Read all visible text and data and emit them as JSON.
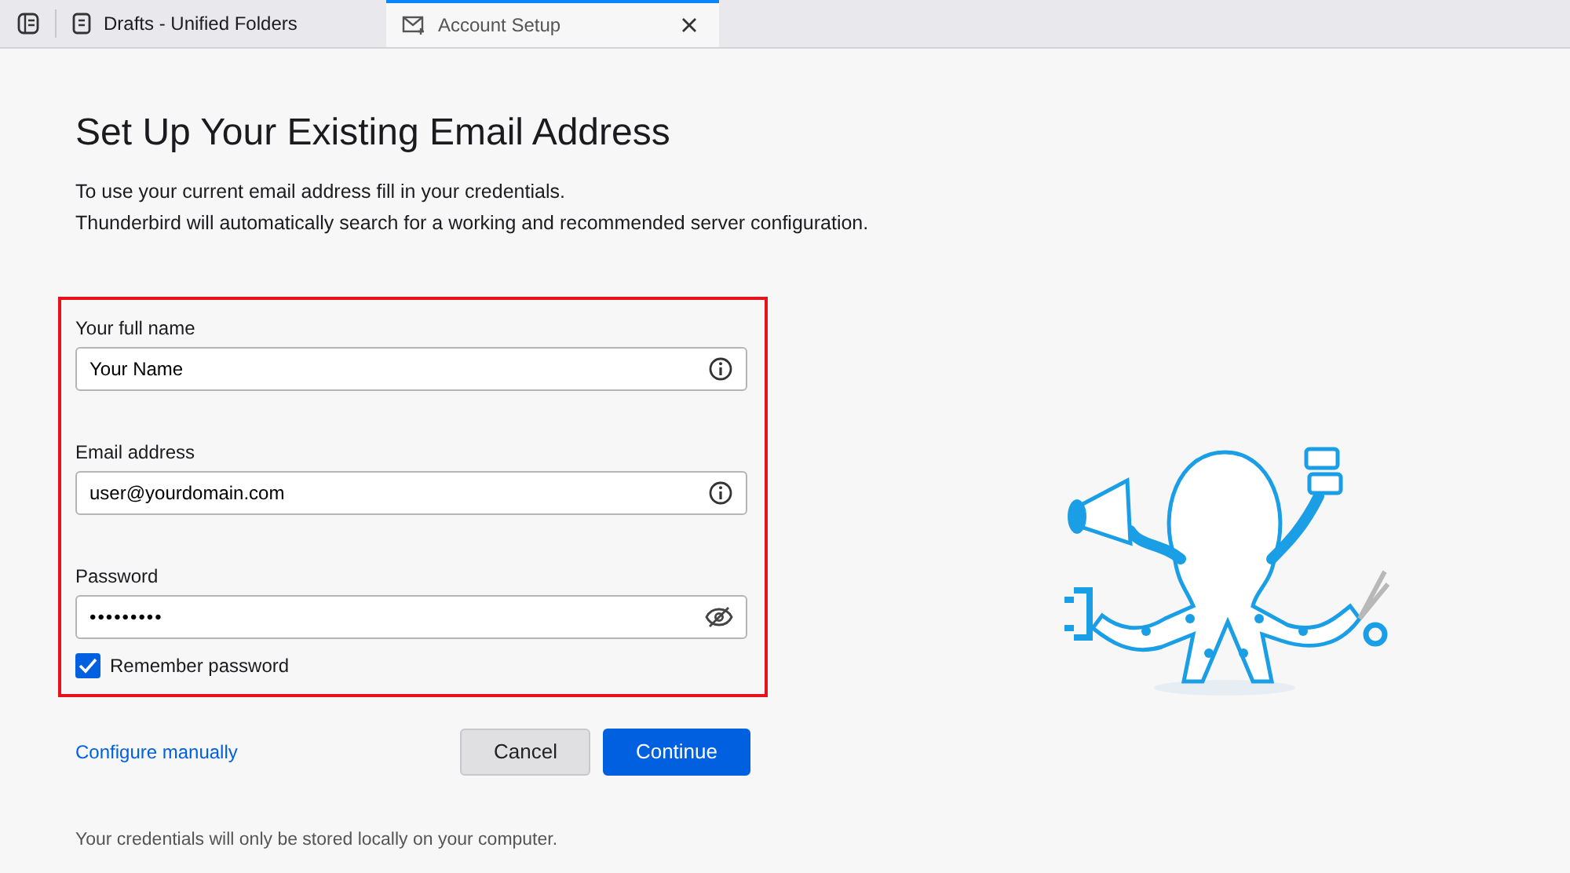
{
  "tabs": [
    {
      "label": "Drafts - Unified Folders",
      "kind": "folder",
      "selected": false,
      "closable": false
    },
    {
      "label": "Account Setup",
      "kind": "mail",
      "selected": true,
      "closable": true
    }
  ],
  "heading": "Set Up Your Existing Email Address",
  "intro": [
    "To use your current email address fill in your credentials.",
    "Thunderbird will automatically search for a working and recommended server configuration."
  ],
  "fields": [
    {
      "label": "Your full name",
      "value": "Your Name",
      "kind": "info"
    },
    {
      "label": "Email address",
      "value": "user@yourdomain.com",
      "kind": "info"
    },
    {
      "label": "Password",
      "value": "•••••••••",
      "kind": "password"
    }
  ],
  "remember_password": {
    "label": "Remember password",
    "checked": true
  },
  "configure_link": "Configure manually",
  "buttons": [
    {
      "label": "Cancel",
      "kind": "secondary"
    },
    {
      "label": "Continue",
      "kind": "primary"
    }
  ],
  "footer_note": "Your credentials will only be stored locally on your computer."
}
